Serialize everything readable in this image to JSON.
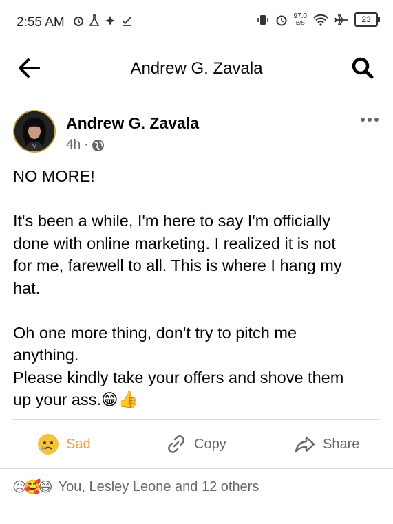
{
  "status_bar": {
    "time": "2:55 AM",
    "left_icons": [
      "alarm-icon",
      "flask-icon",
      "sparkle-icon",
      "check-icon"
    ],
    "net_speed_value": "97.0",
    "net_speed_unit": "B/S",
    "battery": "23"
  },
  "header": {
    "title": "Andrew G. Zavala",
    "back_icon": "arrow-left-icon",
    "search_icon": "search-icon"
  },
  "post": {
    "author": "Andrew G. Zavala",
    "time": "4h",
    "meta_sep": " ·",
    "privacy_icon": "globe-icon",
    "lines": {
      "l1": "NO MORE!",
      "l2": "It's been a while, I'm here to say I'm officially",
      "l3": "done with online marketing. I realized it is not",
      "l4": "for me, farewell to all. This is where I hang my",
      "l5": "hat.",
      "l6": "Oh one more thing, don't try to pitch me",
      "l7": "anything.",
      "l8": "Please kindly take your offers and shove them",
      "l9": "up your ass.😁👍"
    }
  },
  "actions": {
    "sad_label": "Sad",
    "copy_label": "Copy",
    "share_label": "Share",
    "sad_color": "#e7a33c"
  },
  "reactions": {
    "emojis": [
      "😥",
      "🥰",
      "😄"
    ],
    "summary": "You, Lesley Leone and 12 others"
  }
}
